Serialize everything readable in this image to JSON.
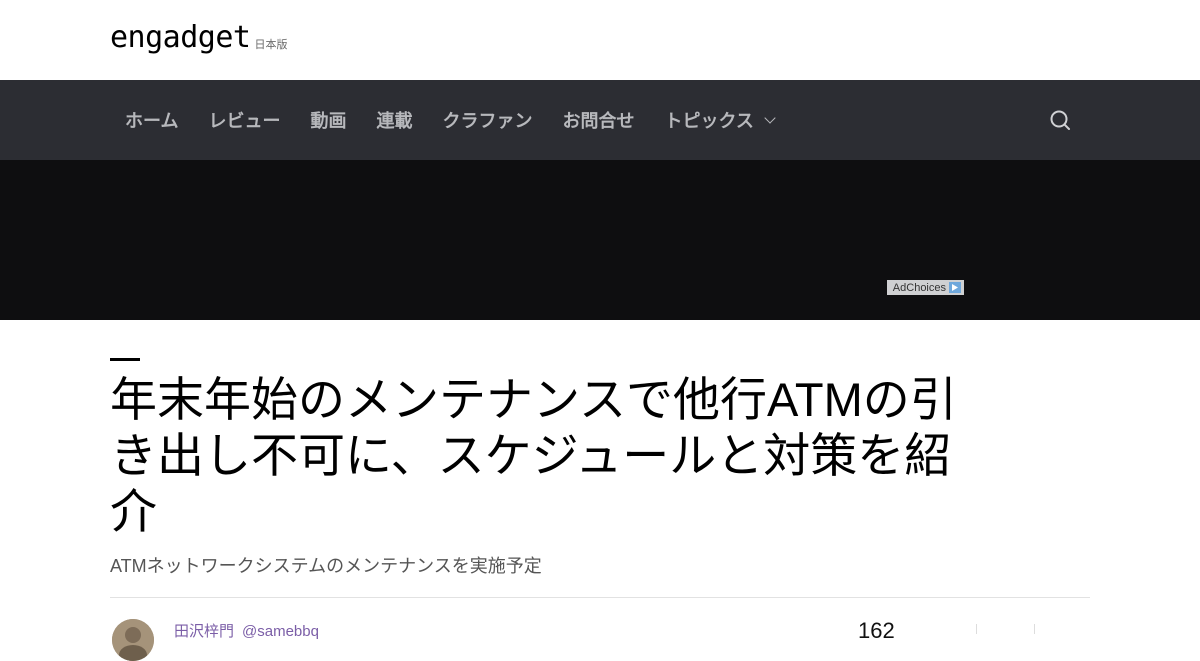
{
  "header": {
    "logo_text": "engadget",
    "edition": "日本版"
  },
  "nav": {
    "items": [
      {
        "label": "ホーム"
      },
      {
        "label": "レビュー"
      },
      {
        "label": "動画"
      },
      {
        "label": "連載"
      },
      {
        "label": "クラファン"
      },
      {
        "label": "お問合せ"
      },
      {
        "label": "トピックス",
        "has_dropdown": true
      }
    ],
    "search_icon": "search-icon",
    "background": "#2c2d33"
  },
  "ad": {
    "adchoices_label": "AdChoices",
    "background": "#0e0e10"
  },
  "article": {
    "title": "年末年始のメンテナンスで他行ATMの引き出し不可に、スケジュールと対策を紹介",
    "subtitle": "ATMネットワークシステムのメンテナンスを実施予定",
    "author_name": "田沢梓門",
    "author_handle": "@samebbq",
    "share_count": "162"
  },
  "colors": {
    "author_link": "#7b5ea7"
  }
}
